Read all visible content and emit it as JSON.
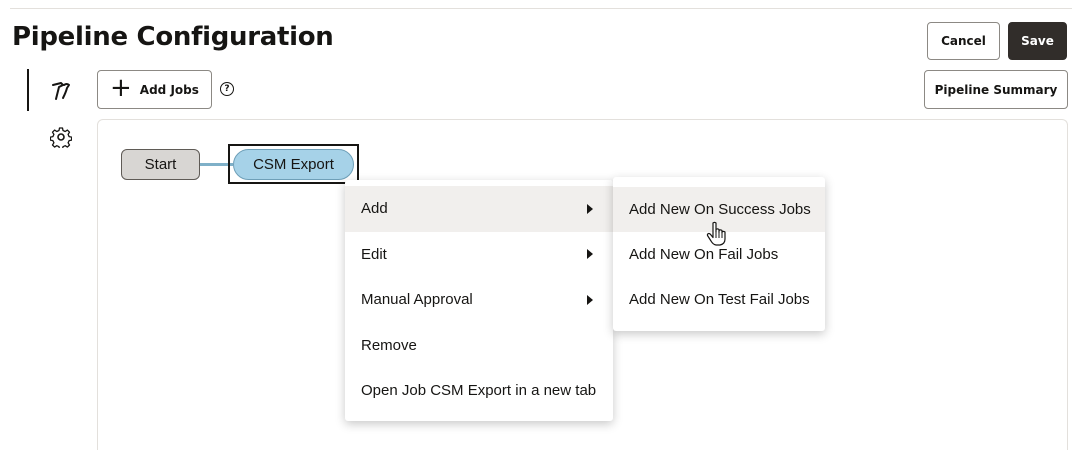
{
  "header": {
    "title": "Pipeline Configuration",
    "cancel_label": "Cancel",
    "save_label": "Save"
  },
  "toolbar": {
    "add_jobs_label": "Add Jobs",
    "pipeline_summary_label": "Pipeline Summary",
    "help_icon": "help-circle-icon"
  },
  "side_tabs": [
    {
      "name": "tools",
      "icon": "tools-icon",
      "selected": true
    },
    {
      "name": "settings",
      "icon": "gear-icon",
      "selected": false
    }
  ],
  "pipeline": {
    "start_label": "Start",
    "job_label": "CSM Export"
  },
  "context_menu": {
    "items": [
      {
        "label": "Add",
        "has_submenu": true,
        "active": true
      },
      {
        "label": "Edit",
        "has_submenu": true
      },
      {
        "label": "Manual Approval",
        "has_submenu": true
      },
      {
        "label": "Remove",
        "has_submenu": false
      },
      {
        "label": "Open Job CSM Export in a new tab",
        "has_submenu": false
      }
    ]
  },
  "submenu": {
    "items": [
      {
        "label": "Add New On Success Jobs",
        "hovered": true
      },
      {
        "label": "Add New On Fail Jobs"
      },
      {
        "label": "Add New On Test Fail Jobs"
      }
    ]
  },
  "colors": {
    "primary_button": "#312d2a",
    "job_node": "#a6d2e8",
    "start_node": "#d8d6d3"
  }
}
